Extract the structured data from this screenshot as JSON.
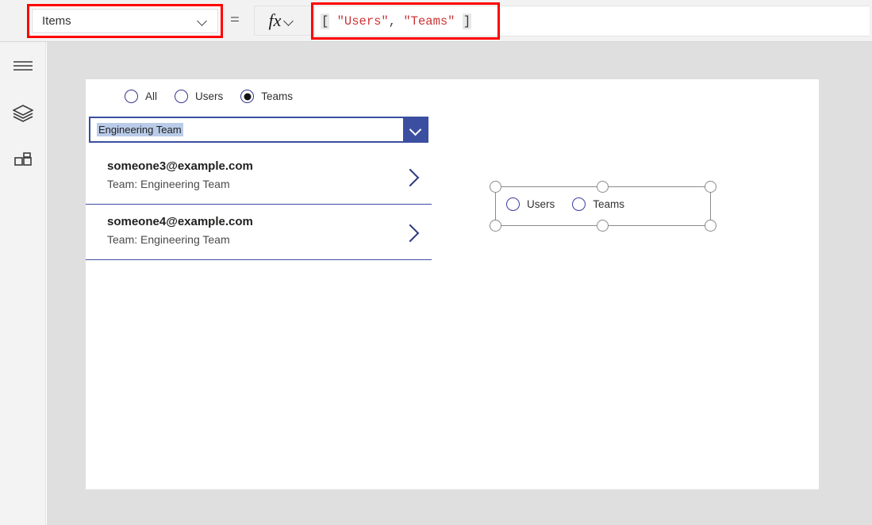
{
  "formula_bar": {
    "property_label": "Items",
    "equals": "=",
    "fx_label": "fx",
    "formula_tokens": {
      "open_bracket": "[",
      "space1": " ",
      "string1": "\"Users\"",
      "comma": ",",
      "space2": " ",
      "string2": "\"Teams\"",
      "space3": " ",
      "close_bracket": "]"
    },
    "formula_text": "[ \"Users\", \"Teams\" ]",
    "highlight_color": "#ff0000"
  },
  "sidebar": {
    "items": [
      {
        "icon": "hamburger-menu-icon",
        "label": "Menu"
      },
      {
        "icon": "tree-view-layers-icon",
        "label": "Tree view"
      },
      {
        "icon": "insert-components-icon",
        "label": "Insert"
      }
    ]
  },
  "app_screen": {
    "filter_radio": {
      "options": [
        {
          "label": "All",
          "checked": false
        },
        {
          "label": "Users",
          "checked": false
        },
        {
          "label": "Teams",
          "checked": true
        }
      ]
    },
    "combobox": {
      "value": "Engineering Team",
      "chevron_icon": "chevron-down-icon",
      "accent_color": "#3b4ea0"
    },
    "gallery": {
      "items": [
        {
          "title": "someone3@example.com",
          "subtitle": "Team: Engineering Team",
          "chevron_icon": "chevron-right-icon"
        },
        {
          "title": "someone4@example.com",
          "subtitle": "Team: Engineering Team",
          "chevron_icon": "chevron-right-icon"
        }
      ]
    }
  },
  "selected_control": {
    "options": [
      {
        "label": "Users",
        "checked": false
      },
      {
        "label": "Teams",
        "checked": false
      }
    ],
    "handle_count": 6
  }
}
